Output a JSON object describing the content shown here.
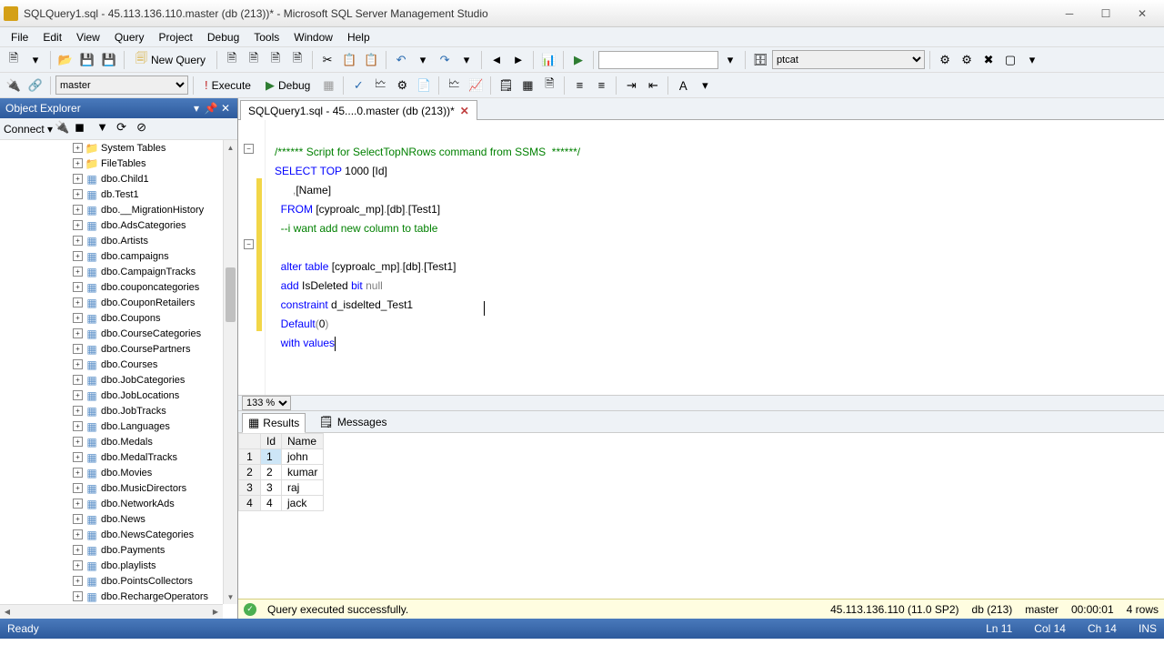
{
  "title": "SQLQuery1.sql - 45.113.136.110.master (db (213))* - Microsoft SQL Server Management Studio",
  "menu": [
    "File",
    "Edit",
    "View",
    "Query",
    "Project",
    "Debug",
    "Tools",
    "Window",
    "Help"
  ],
  "newQuery": "New Query",
  "execute": "Execute",
  "debug": "Debug",
  "dbCombo": "master",
  "userCombo": "ptcat",
  "objectExplorer": {
    "title": "Object Explorer",
    "connect": "Connect",
    "nodes": [
      {
        "label": "System Tables",
        "exp": "+",
        "folder": true
      },
      {
        "label": "FileTables",
        "exp": "+",
        "folder": true
      },
      {
        "label": "dbo.Child1",
        "exp": "+"
      },
      {
        "label": "db.Test1",
        "exp": "+"
      },
      {
        "label": "dbo.__MigrationHistory",
        "exp": "+"
      },
      {
        "label": "dbo.AdsCategories",
        "exp": "+"
      },
      {
        "label": "dbo.Artists",
        "exp": "+"
      },
      {
        "label": "dbo.campaigns",
        "exp": "+"
      },
      {
        "label": "dbo.CampaignTracks",
        "exp": "+"
      },
      {
        "label": "dbo.couponcategories",
        "exp": "+"
      },
      {
        "label": "dbo.CouponRetailers",
        "exp": "+"
      },
      {
        "label": "dbo.Coupons",
        "exp": "+"
      },
      {
        "label": "dbo.CourseCategories",
        "exp": "+"
      },
      {
        "label": "dbo.CoursePartners",
        "exp": "+"
      },
      {
        "label": "dbo.Courses",
        "exp": "+"
      },
      {
        "label": "dbo.JobCategories",
        "exp": "+"
      },
      {
        "label": "dbo.JobLocations",
        "exp": "+"
      },
      {
        "label": "dbo.JobTracks",
        "exp": "+"
      },
      {
        "label": "dbo.Languages",
        "exp": "+"
      },
      {
        "label": "dbo.Medals",
        "exp": "+"
      },
      {
        "label": "dbo.MedalTracks",
        "exp": "+"
      },
      {
        "label": "dbo.Movies",
        "exp": "+"
      },
      {
        "label": "dbo.MusicDirectors",
        "exp": "+"
      },
      {
        "label": "dbo.NetworkAds",
        "exp": "+"
      },
      {
        "label": "dbo.News",
        "exp": "+"
      },
      {
        "label": "dbo.NewsCategories",
        "exp": "+"
      },
      {
        "label": "dbo.Payments",
        "exp": "+"
      },
      {
        "label": "dbo.playlists",
        "exp": "+"
      },
      {
        "label": "dbo.PointsCollectors",
        "exp": "+"
      },
      {
        "label": "dbo.RechargeOperators",
        "exp": "+"
      }
    ]
  },
  "tab": "SQLQuery1.sql - 45....0.master (db (213))*",
  "code": {
    "l1": "/****** Script for SelectTopNRows command from SSMS  ******/",
    "l2a": "SELECT",
    "l2b": " TOP",
    "l2c": " 1000",
    "l2d": " [Id]",
    "l3a": "      ,",
    "l3b": "[Name]",
    "l4a": "  FROM",
    "l4b": " [cyproalc_mp]",
    "l4c": ".",
    "l4d": "[db]",
    "l4e": ".",
    "l4f": "[Test1]",
    "l5": "  --i want add new column to table",
    "l6": "",
    "l7a": "  alter",
    "l7b": " table",
    "l7c": " [cyproalc_mp]",
    "l7d": ".",
    "l7e": "[db]",
    "l7f": ".",
    "l7g": "[Test1]",
    "l8a": "  add",
    "l8b": " IsDeleted ",
    "l8c": "bit",
    "l8d": " null",
    "l9a": "  constraint",
    "l9b": " d_isdelted_Test1",
    "l10a": "  Default",
    "l10b": "(",
    "l10c": "0",
    "l10d": ")",
    "l11a": "  with",
    "l11b": " values"
  },
  "zoom": "133 %",
  "resultsTabs": {
    "results": "Results",
    "messages": "Messages"
  },
  "grid": {
    "headers": [
      "",
      "Id",
      "Name"
    ],
    "rows": [
      [
        "1",
        "1",
        "john"
      ],
      [
        "2",
        "2",
        "kumar"
      ],
      [
        "3",
        "3",
        "raj"
      ],
      [
        "4",
        "4",
        "jack"
      ]
    ]
  },
  "queryStatus": "Query executed successfully.",
  "connInfo": {
    "server": "45.113.136.110 (11.0 SP2)",
    "db": "db (213)",
    "user": "master",
    "time": "00:00:01",
    "rows": "4 rows"
  },
  "status": {
    "ready": "Ready",
    "ln": "Ln 11",
    "col": "Col 14",
    "ch": "Ch 14",
    "ins": "INS"
  }
}
